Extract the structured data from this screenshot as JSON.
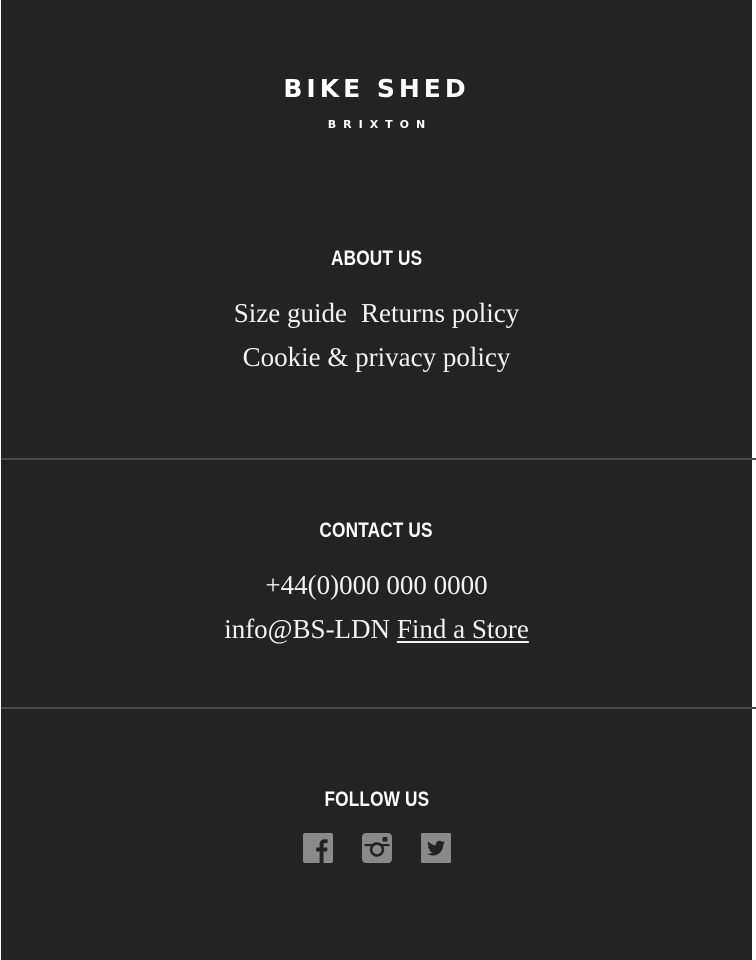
{
  "brand": {
    "name": "BIKE SHED",
    "location": "BRIXTON"
  },
  "about": {
    "heading": "ABOUT US",
    "links": [
      "Size guide",
      "Returns policy",
      "Cookie & privacy policy"
    ]
  },
  "contact": {
    "heading": "CONTACT US",
    "phone": "+44(0)000 000 0000",
    "email": "info@BS-LDN",
    "store_link": "Find a Store"
  },
  "follow": {
    "heading": "FOLLOW US",
    "icons": [
      "facebook-icon",
      "instagram-icon",
      "twitter-icon"
    ],
    "icon_color": "#8a8a8a"
  },
  "colors": {
    "background": "#232323",
    "text": "#f2f2f2",
    "divider": "#4a4a4a"
  }
}
